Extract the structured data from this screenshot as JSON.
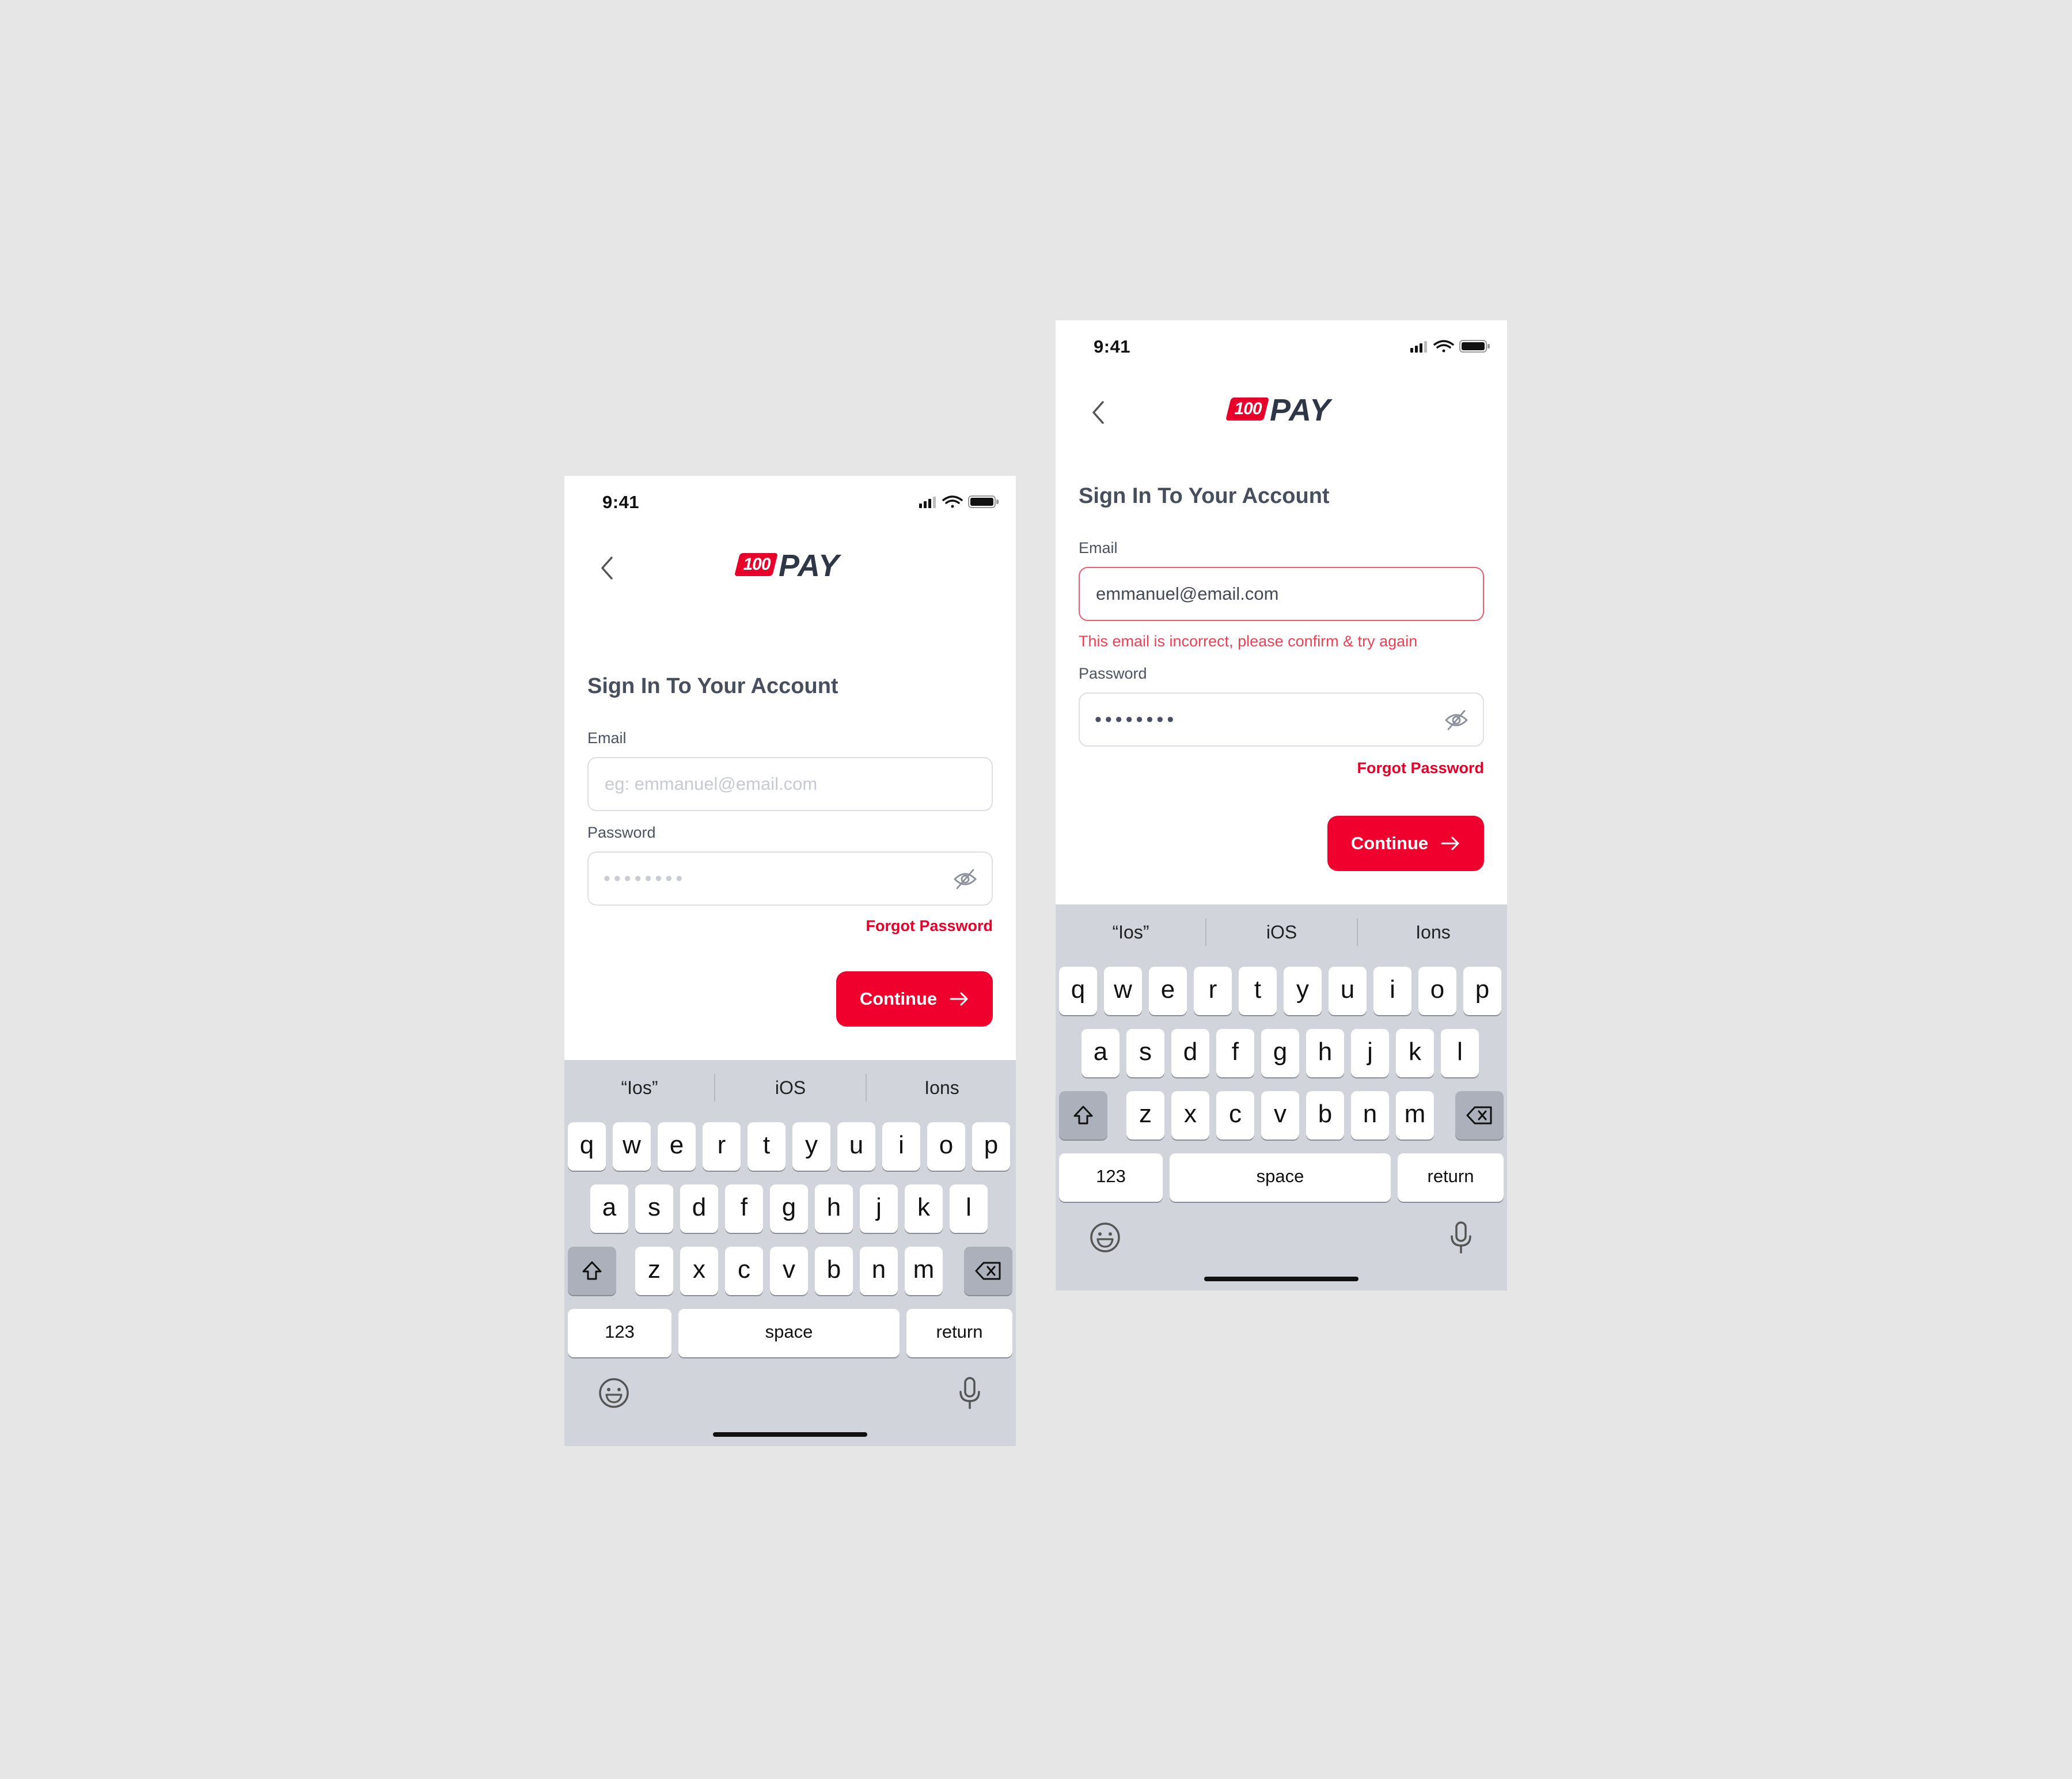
{
  "phones": [
    {
      "status_time": "9:41",
      "logo": {
        "badge": "100",
        "word": "PAY"
      },
      "title": "Sign In To Your Account",
      "email_label": "Email",
      "email_value": "",
      "email_placeholder": "eg: emmanuel@email.com",
      "email_error": "",
      "password_label": "Password",
      "password_mask": "••••••••",
      "password_state": "placeholder",
      "forgot_label": "Forgot Password",
      "continue_label": "Continue"
    },
    {
      "status_time": "9:41",
      "logo": {
        "badge": "100",
        "word": "PAY"
      },
      "title": "Sign In To Your Account",
      "email_label": "Email",
      "email_value": "emmanuel@email.com",
      "email_placeholder": "",
      "email_error": "This email is incorrect, please confirm & try again",
      "password_label": "Password",
      "password_mask": "••••••••",
      "password_state": "filled",
      "forgot_label": "Forgot Password",
      "continue_label": "Continue"
    }
  ],
  "keyboard": {
    "suggestions": [
      "“Ios”",
      "iOS",
      "Ions"
    ],
    "row1": [
      "q",
      "w",
      "e",
      "r",
      "t",
      "y",
      "u",
      "i",
      "o",
      "p"
    ],
    "row2": [
      "a",
      "s",
      "d",
      "f",
      "g",
      "h",
      "j",
      "k",
      "l"
    ],
    "row3": [
      "z",
      "x",
      "c",
      "v",
      "b",
      "n",
      "m"
    ],
    "numbers_label": "123",
    "space_label": "space",
    "return_label": "return"
  },
  "icons": {
    "back": "chevron-left-icon",
    "eye": "eye-off-icon",
    "shift": "shift-icon",
    "delete": "backspace-icon",
    "emoji": "emoji-icon",
    "mic": "microphone-icon",
    "signal": "signal-icon",
    "wifi": "wifi-icon",
    "battery": "battery-icon"
  },
  "colors": {
    "brand_red": "#e8002b",
    "error_red": "#ec4057",
    "text_dark": "#3a4150",
    "keyboard_bg": "#d1d4da"
  }
}
